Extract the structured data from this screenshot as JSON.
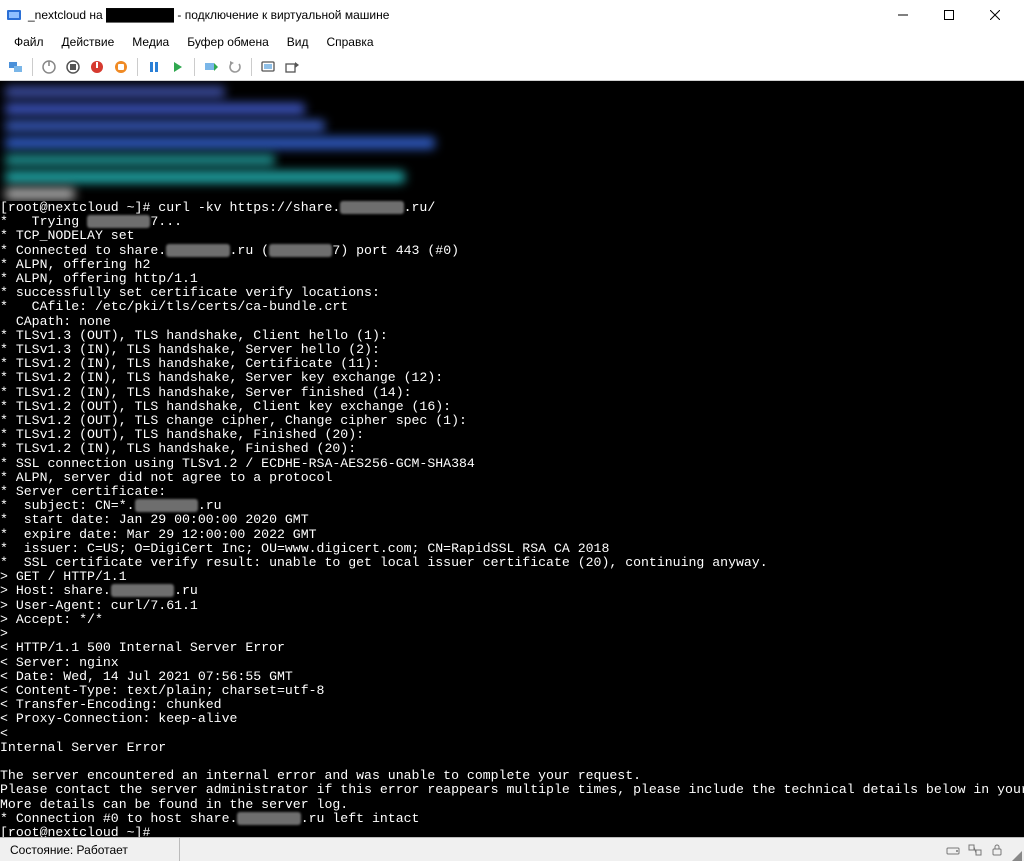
{
  "window": {
    "title": "_nextcloud на ████████ - подключение к виртуальной машине"
  },
  "menu": {
    "file": "Файл",
    "action": "Действие",
    "media": "Медиа",
    "clipboard": "Буфер обмена",
    "view": "Вид",
    "help": "Справка"
  },
  "statusbar": {
    "text": "Состояние: Работает"
  },
  "terminal": {
    "lines": [
      "[root@nextcloud ~]# curl -kv https://share.████████.ru/",
      "*   Trying ████████7...",
      "* TCP_NODELAY set",
      "* Connected to share.████████.ru (████████7) port 443 (#0)",
      "* ALPN, offering h2",
      "* ALPN, offering http/1.1",
      "* successfully set certificate verify locations:",
      "*   CAfile: /etc/pki/tls/certs/ca-bundle.crt",
      "  CApath: none",
      "* TLSv1.3 (OUT), TLS handshake, Client hello (1):",
      "* TLSv1.3 (IN), TLS handshake, Server hello (2):",
      "* TLSv1.2 (IN), TLS handshake, Certificate (11):",
      "* TLSv1.2 (IN), TLS handshake, Server key exchange (12):",
      "* TLSv1.2 (IN), TLS handshake, Server finished (14):",
      "* TLSv1.2 (OUT), TLS handshake, Client key exchange (16):",
      "* TLSv1.2 (OUT), TLS change cipher, Change cipher spec (1):",
      "* TLSv1.2 (OUT), TLS handshake, Finished (20):",
      "* TLSv1.2 (IN), TLS handshake, Finished (20):",
      "* SSL connection using TLSv1.2 / ECDHE-RSA-AES256-GCM-SHA384",
      "* ALPN, server did not agree to a protocol",
      "* Server certificate:",
      "*  subject: CN=*.████████.ru",
      "*  start date: Jan 29 00:00:00 2020 GMT",
      "*  expire date: Mar 29 12:00:00 2022 GMT",
      "*  issuer: C=US; O=DigiCert Inc; OU=www.digicert.com; CN=RapidSSL RSA CA 2018",
      "*  SSL certificate verify result: unable to get local issuer certificate (20), continuing anyway.",
      "> GET / HTTP/1.1",
      "> Host: share.████████.ru",
      "> User-Agent: curl/7.61.1",
      "> Accept: */*",
      "> ",
      "< HTTP/1.1 500 Internal Server Error",
      "< Server: nginx",
      "< Date: Wed, 14 Jul 2021 07:56:55 GMT",
      "< Content-Type: text/plain; charset=utf-8",
      "< Transfer-Encoding: chunked",
      "< Proxy-Connection: keep-alive",
      "< ",
      "Internal Server Error",
      "",
      "The server encountered an internal error and was unable to complete your request.",
      "Please contact the server administrator if this error reappears multiple times, please include the technical details below in your report.",
      "More details can be found in the server log.",
      "* Connection #0 to host share.████████.ru left intact",
      "[root@nextcloud ~]# "
    ]
  }
}
